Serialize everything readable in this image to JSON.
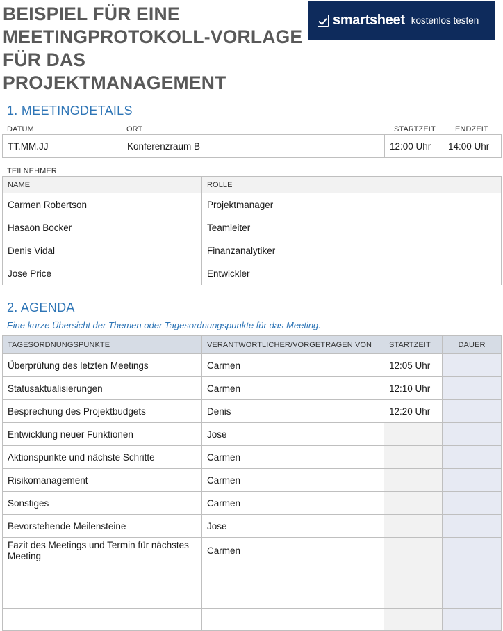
{
  "header": {
    "title_lines": [
      "BEISPIEL FÜR EINE",
      "MEETINGPROTOKOLL-VORLAGE",
      "FÜR DAS PROJEKTMANAGEMENT"
    ],
    "brand": "smartsheet",
    "cta": "kostenlos testen"
  },
  "details": {
    "heading": "1. MEETINGDETAILS",
    "labels": {
      "date": "DATUM",
      "location": "ORT",
      "start": "STARTZEIT",
      "end": "ENDZEIT"
    },
    "values": {
      "date": "TT.MM.JJ",
      "location": "Konferenzraum B",
      "start": "12:00 Uhr",
      "end": "14:00 Uhr"
    }
  },
  "participants": {
    "label": "TEILNEHMER",
    "columns": [
      "NAME",
      "ROLLE"
    ],
    "rows": [
      {
        "name": "Carmen Robertson",
        "role": "Projektmanager"
      },
      {
        "name": "Hasaon Bocker",
        "role": "Teamleiter"
      },
      {
        "name": "Denis Vidal",
        "role": "Finanzanalytiker"
      },
      {
        "name": "Jose Price",
        "role": "Entwickler"
      }
    ]
  },
  "agenda": {
    "heading": "2. AGENDA",
    "intro": "Eine kurze Übersicht der Themen oder Tagesordnungspunkte für das Meeting.",
    "columns": [
      "TAGESORDNUNGSPUNKTE",
      "VERANTWORTLICHER/VORGETRAGEN VON",
      "STARTZEIT",
      "DAUER"
    ],
    "rows": [
      {
        "item": "Überprüfung des letzten Meetings",
        "owner": "Carmen",
        "start": "12:05 Uhr",
        "duration": ""
      },
      {
        "item": "Statusaktualisierungen",
        "owner": "Carmen",
        "start": "12:10 Uhr",
        "duration": ""
      },
      {
        "item": "Besprechung des Projektbudgets",
        "owner": "Denis",
        "start": "12:20 Uhr",
        "duration": ""
      },
      {
        "item": "Entwicklung neuer Funktionen",
        "owner": "Jose",
        "start": "",
        "duration": ""
      },
      {
        "item": "Aktionspunkte und nächste Schritte",
        "owner": "Carmen",
        "start": "",
        "duration": ""
      },
      {
        "item": "Risikomanagement",
        "owner": "Carmen",
        "start": "",
        "duration": ""
      },
      {
        "item": "Sonstiges",
        "owner": "Carmen",
        "start": "",
        "duration": ""
      },
      {
        "item": "Bevorstehende Meilensteine",
        "owner": "Jose",
        "start": "",
        "duration": ""
      },
      {
        "item": "Fazit des Meetings und Termin für nächstes Meeting",
        "owner": "Carmen",
        "start": "",
        "duration": ""
      },
      {
        "item": "",
        "owner": "",
        "start": "",
        "duration": ""
      },
      {
        "item": "",
        "owner": "",
        "start": "",
        "duration": ""
      },
      {
        "item": "",
        "owner": "",
        "start": "",
        "duration": ""
      }
    ]
  }
}
